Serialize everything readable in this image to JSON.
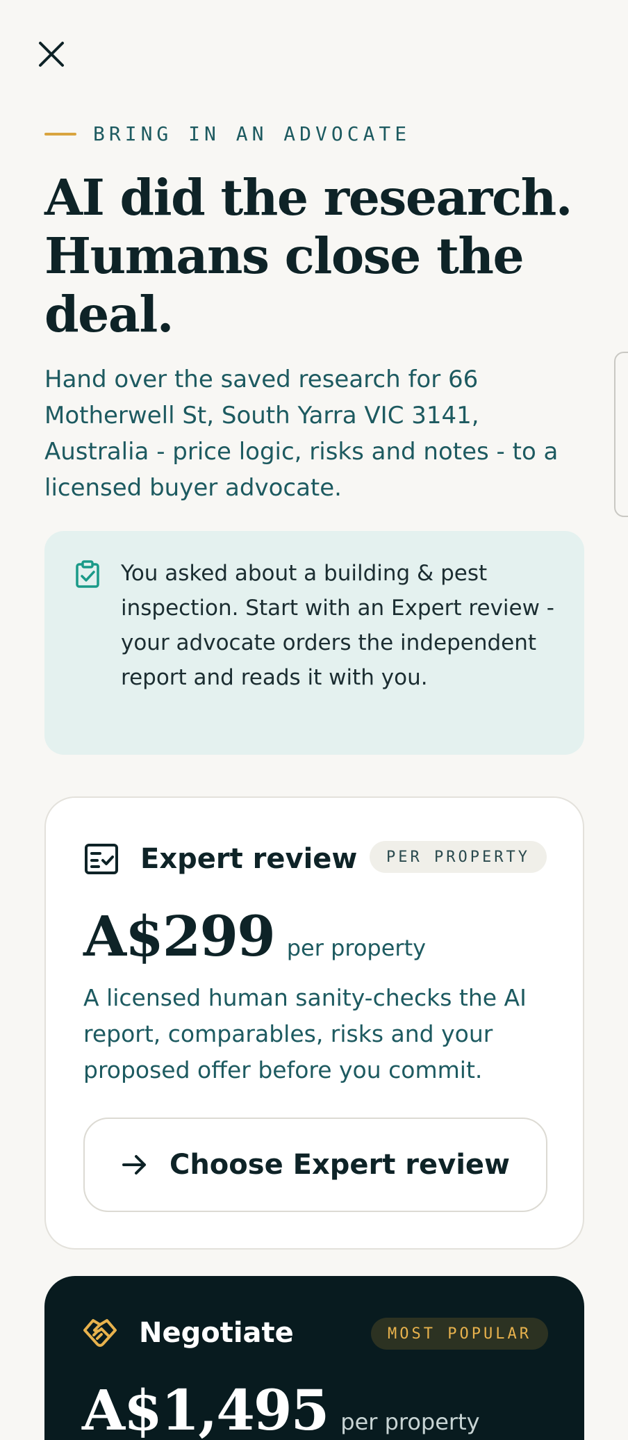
{
  "eyebrow": "BRING IN AN ADVOCATE",
  "headline": "AI did the research. Humans close the deal.",
  "lead": "Hand over the saved research for 66 Motherwell St, South Yarra VIC 3141, Australia - price logic, risks and notes - to a licensed buyer advocate.",
  "notice": {
    "text": "You asked about a building & pest inspection. Start with an Expert review - your advocate orders the independent report and reads it with you."
  },
  "plans": [
    {
      "title": "Expert review",
      "badge": "PER PROPERTY",
      "price": "A$299",
      "unit": "per property",
      "description": "A licensed human sanity-checks the AI report, comparables, risks and your proposed offer before you commit.",
      "cta": "Choose Expert review"
    },
    {
      "title": "Negotiate",
      "badge": "MOST POPULAR",
      "price": "A$1,495",
      "unit": "per property"
    }
  ],
  "colors": {
    "background": "#f8f7f4",
    "accent_gold": "#d9a43f",
    "teal_text": "#1d5a60",
    "notice_bg": "#e4f1ef",
    "dark_card": "#081b1f"
  },
  "icons": {
    "close": "close-icon",
    "notice": "clipboard-check-icon",
    "expert": "checklist-icon",
    "cta": "arrow-right-icon",
    "negotiate": "handshake-icon"
  }
}
